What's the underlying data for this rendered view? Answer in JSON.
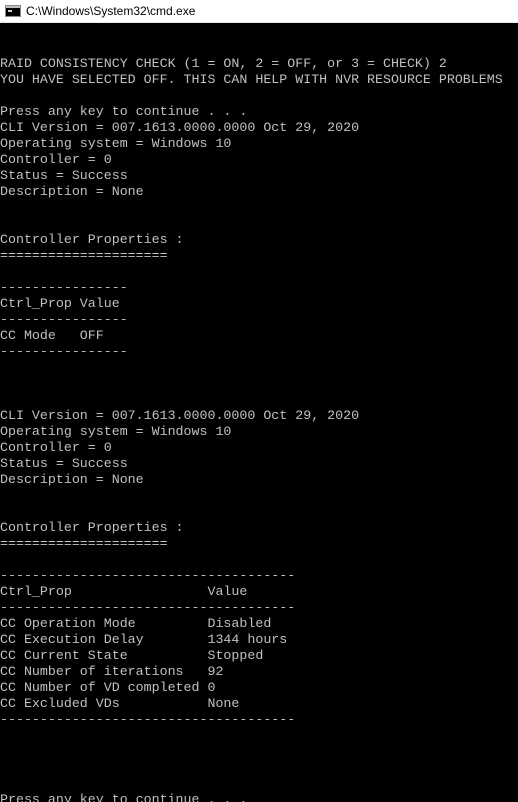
{
  "window": {
    "title": "C:\\Windows\\System32\\cmd.exe",
    "icon": "cmd-console-icon",
    "background_color": "#000000",
    "text_color": "#c0c0c0"
  },
  "console": {
    "lines": [
      "",
      "",
      "RAID CONSISTENCY CHECK (1 = ON, 2 = OFF, or 3 = CHECK) 2",
      "YOU HAVE SELECTED OFF. THIS CAN HELP WITH NVR RESOURCE PROBLEMS",
      "",
      "Press any key to continue . . .",
      "CLI Version = 007.1613.0000.0000 Oct 29, 2020",
      "Operating system = Windows 10",
      "Controller = 0",
      "Status = Success",
      "Description = None",
      "",
      "",
      "Controller Properties :",
      "=====================",
      "",
      "----------------",
      "Ctrl_Prop Value",
      "----------------",
      "CC Mode   OFF",
      "----------------",
      "",
      "",
      "",
      "CLI Version = 007.1613.0000.0000 Oct 29, 2020",
      "Operating system = Windows 10",
      "Controller = 0",
      "Status = Success",
      "Description = None",
      "",
      "",
      "Controller Properties :",
      "=====================",
      "",
      "-------------------------------------",
      "Ctrl_Prop                 Value",
      "-------------------------------------",
      "CC Operation Mode         Disabled",
      "CC Execution Delay        1344 hours",
      "CC Current State          Stopped",
      "CC Number of iterations   92",
      "CC Number of VD completed 0",
      "CC Excluded VDs           None",
      "-------------------------------------",
      "",
      "",
      "",
      "",
      "Press any key to continue . . ."
    ]
  }
}
